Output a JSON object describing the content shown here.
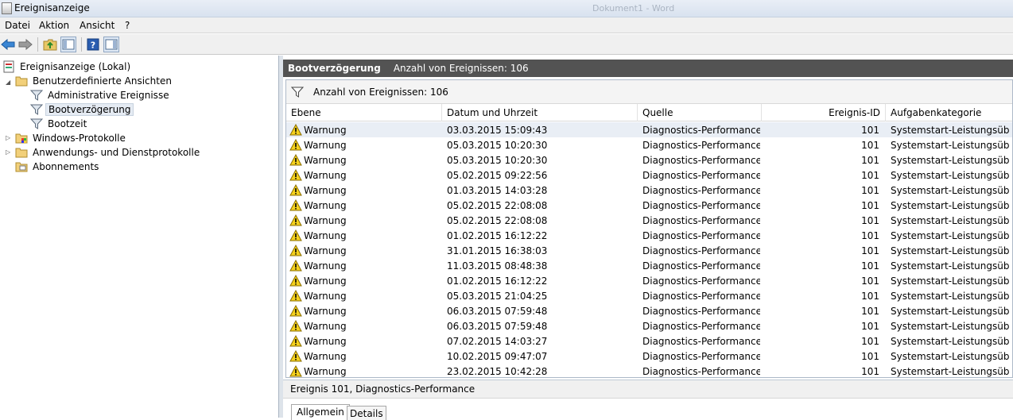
{
  "window": {
    "title": "Ereignisanzeige",
    "ghost_title": "Dokument1 - Word"
  },
  "menu": {
    "items": [
      "Datei",
      "Aktion",
      "Ansicht",
      "?"
    ]
  },
  "tree": {
    "root": "Ereignisanzeige (Lokal)",
    "custom_views": "Benutzerdefinierte Ansichten",
    "admin_events": "Administrative Ereignisse",
    "boot_delay": "Bootverzögerung",
    "boot_time": "Bootzeit",
    "windows_logs": "Windows-Protokolle",
    "app_service_logs": "Anwendungs- und Dienstprotokolle",
    "subscriptions": "Abonnements"
  },
  "header": {
    "title": "Bootverzögerung",
    "count_label": "Anzahl von Ereignissen: 106"
  },
  "filter": {
    "label": "Anzahl von Ereignissen: 106"
  },
  "columns": {
    "level": "Ebene",
    "datetime": "Datum und Uhrzeit",
    "source": "Quelle",
    "event_id": "Ereignis-ID",
    "category": "Aufgabenkategorie"
  },
  "events": [
    {
      "level": "Warnung",
      "datetime": "03.03.2015 15:09:43",
      "source": "Diagnostics-Performance",
      "event_id": "101",
      "category": "Systemstart-Leistungsübe..."
    },
    {
      "level": "Warnung",
      "datetime": "05.03.2015 10:20:30",
      "source": "Diagnostics-Performance",
      "event_id": "101",
      "category": "Systemstart-Leistungsübe..."
    },
    {
      "level": "Warnung",
      "datetime": "05.03.2015 10:20:30",
      "source": "Diagnostics-Performance",
      "event_id": "101",
      "category": "Systemstart-Leistungsübe..."
    },
    {
      "level": "Warnung",
      "datetime": "05.02.2015 09:22:56",
      "source": "Diagnostics-Performance",
      "event_id": "101",
      "category": "Systemstart-Leistungsübe..."
    },
    {
      "level": "Warnung",
      "datetime": "01.03.2015 14:03:28",
      "source": "Diagnostics-Performance",
      "event_id": "101",
      "category": "Systemstart-Leistungsübe..."
    },
    {
      "level": "Warnung",
      "datetime": "05.02.2015 22:08:08",
      "source": "Diagnostics-Performance",
      "event_id": "101",
      "category": "Systemstart-Leistungsübe..."
    },
    {
      "level": "Warnung",
      "datetime": "05.02.2015 22:08:08",
      "source": "Diagnostics-Performance",
      "event_id": "101",
      "category": "Systemstart-Leistungsübe..."
    },
    {
      "level": "Warnung",
      "datetime": "01.02.2015 16:12:22",
      "source": "Diagnostics-Performance",
      "event_id": "101",
      "category": "Systemstart-Leistungsübe..."
    },
    {
      "level": "Warnung",
      "datetime": "31.01.2015 16:38:03",
      "source": "Diagnostics-Performance",
      "event_id": "101",
      "category": "Systemstart-Leistungsübe..."
    },
    {
      "level": "Warnung",
      "datetime": "11.03.2015 08:48:38",
      "source": "Diagnostics-Performance",
      "event_id": "101",
      "category": "Systemstart-Leistungsübe..."
    },
    {
      "level": "Warnung",
      "datetime": "01.02.2015 16:12:22",
      "source": "Diagnostics-Performance",
      "event_id": "101",
      "category": "Systemstart-Leistungsübe..."
    },
    {
      "level": "Warnung",
      "datetime": "05.03.2015 21:04:25",
      "source": "Diagnostics-Performance",
      "event_id": "101",
      "category": "Systemstart-Leistungsübe..."
    },
    {
      "level": "Warnung",
      "datetime": "06.03.2015 07:59:48",
      "source": "Diagnostics-Performance",
      "event_id": "101",
      "category": "Systemstart-Leistungsübe..."
    },
    {
      "level": "Warnung",
      "datetime": "06.03.2015 07:59:48",
      "source": "Diagnostics-Performance",
      "event_id": "101",
      "category": "Systemstart-Leistungsübe..."
    },
    {
      "level": "Warnung",
      "datetime": "07.02.2015 14:03:27",
      "source": "Diagnostics-Performance",
      "event_id": "101",
      "category": "Systemstart-Leistungsübe..."
    },
    {
      "level": "Warnung",
      "datetime": "10.02.2015 09:47:07",
      "source": "Diagnostics-Performance",
      "event_id": "101",
      "category": "Systemstart-Leistungsübe..."
    },
    {
      "level": "Warnung",
      "datetime": "23.02.2015 10:42:28",
      "source": "Diagnostics-Performance",
      "event_id": "101",
      "category": "Systemstart-Leistungsübe..."
    }
  ],
  "detail": {
    "title": "Ereignis 101, Diagnostics-Performance"
  },
  "tabs": [
    "Allgemein",
    "Details"
  ],
  "icons": {
    "back": "back-arrow-icon",
    "forward": "forward-arrow-icon",
    "up": "folder-up-icon",
    "show_hide": "console-tree-icon",
    "help": "help-icon",
    "action_pane": "action-pane-icon",
    "filter": "filter-icon",
    "warning": "warning-icon"
  },
  "colors": {
    "header_bg": "#535353",
    "selection_bg": "#e5ebf3",
    "warning_yellow": "#f5d11e"
  }
}
